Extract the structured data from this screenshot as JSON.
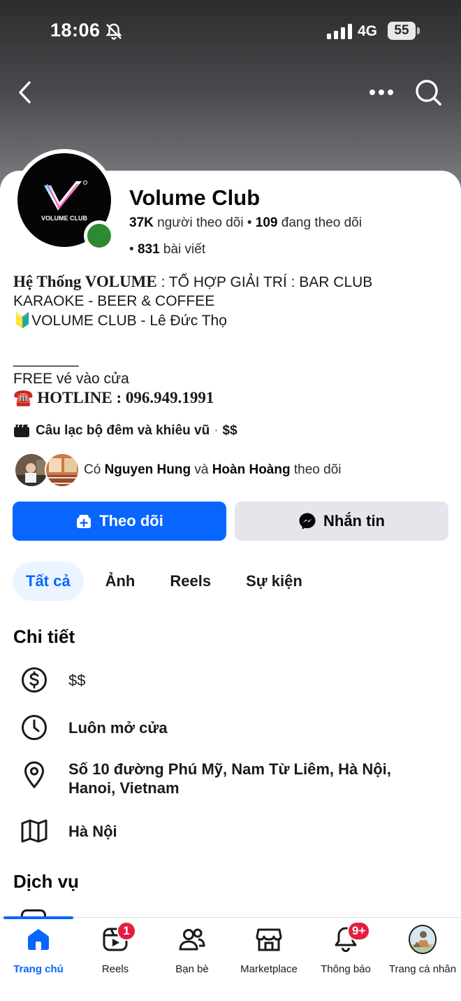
{
  "status_bar": {
    "time": "18:06",
    "network": "4G",
    "battery": "55"
  },
  "page": {
    "name": "Volume Club",
    "followers_count": "37K",
    "followers_label": "người theo dõi",
    "following_count": "109",
    "following_label": "đang theo dõi",
    "posts_count": "831",
    "posts_label": "bài viết",
    "logo_text": "VOLUME CLUB"
  },
  "bio": {
    "line1_bold": "Hệ Thống VOLUME",
    "line1_rest": " : TỔ HỢP GIẢI TRÍ : BAR CLUB",
    "line2": "KARAOKE - BEER & COFFEE",
    "line3": "🔰VOLUME CLUB - Lê Đức Thọ",
    "line4": "________",
    "line5": "FREE vé vào cửa",
    "line6": "☎️ HOTLINE : 096.949.1991"
  },
  "category": {
    "label": "Câu lạc bộ đêm và khiêu vũ",
    "price": "$$"
  },
  "mutual": {
    "prefix": "Có ",
    "name1": "Nguyen Hung",
    "joiner": " và ",
    "name2": "Hoàn Hoàng",
    "suffix": " theo dõi"
  },
  "actions": {
    "follow": "Theo dõi",
    "message": "Nhắn tin"
  },
  "tabs": [
    "Tất cả",
    "Ảnh",
    "Reels",
    "Sự kiện"
  ],
  "details": {
    "title": "Chi tiết",
    "price": "$$",
    "hours": "Luôn mở cửa",
    "address_line1": "Số 10 đường Phú Mỹ, Nam Từ Liêm, Hà Nội,",
    "address_line2": "Hanoi, Vietnam",
    "city": "Hà Nội"
  },
  "services_title": "Dịch vụ",
  "bottom_nav": {
    "home": "Trang chủ",
    "reels": "Reels",
    "reels_badge": "1",
    "friends": "Bạn bè",
    "marketplace": "Marketplace",
    "notifications": "Thông báo",
    "notifications_badge": "9+",
    "profile": "Trang cá nhân"
  },
  "colors": {
    "primary": "#0866ff",
    "online": "#2d8a33",
    "badge": "#e41e3f"
  }
}
